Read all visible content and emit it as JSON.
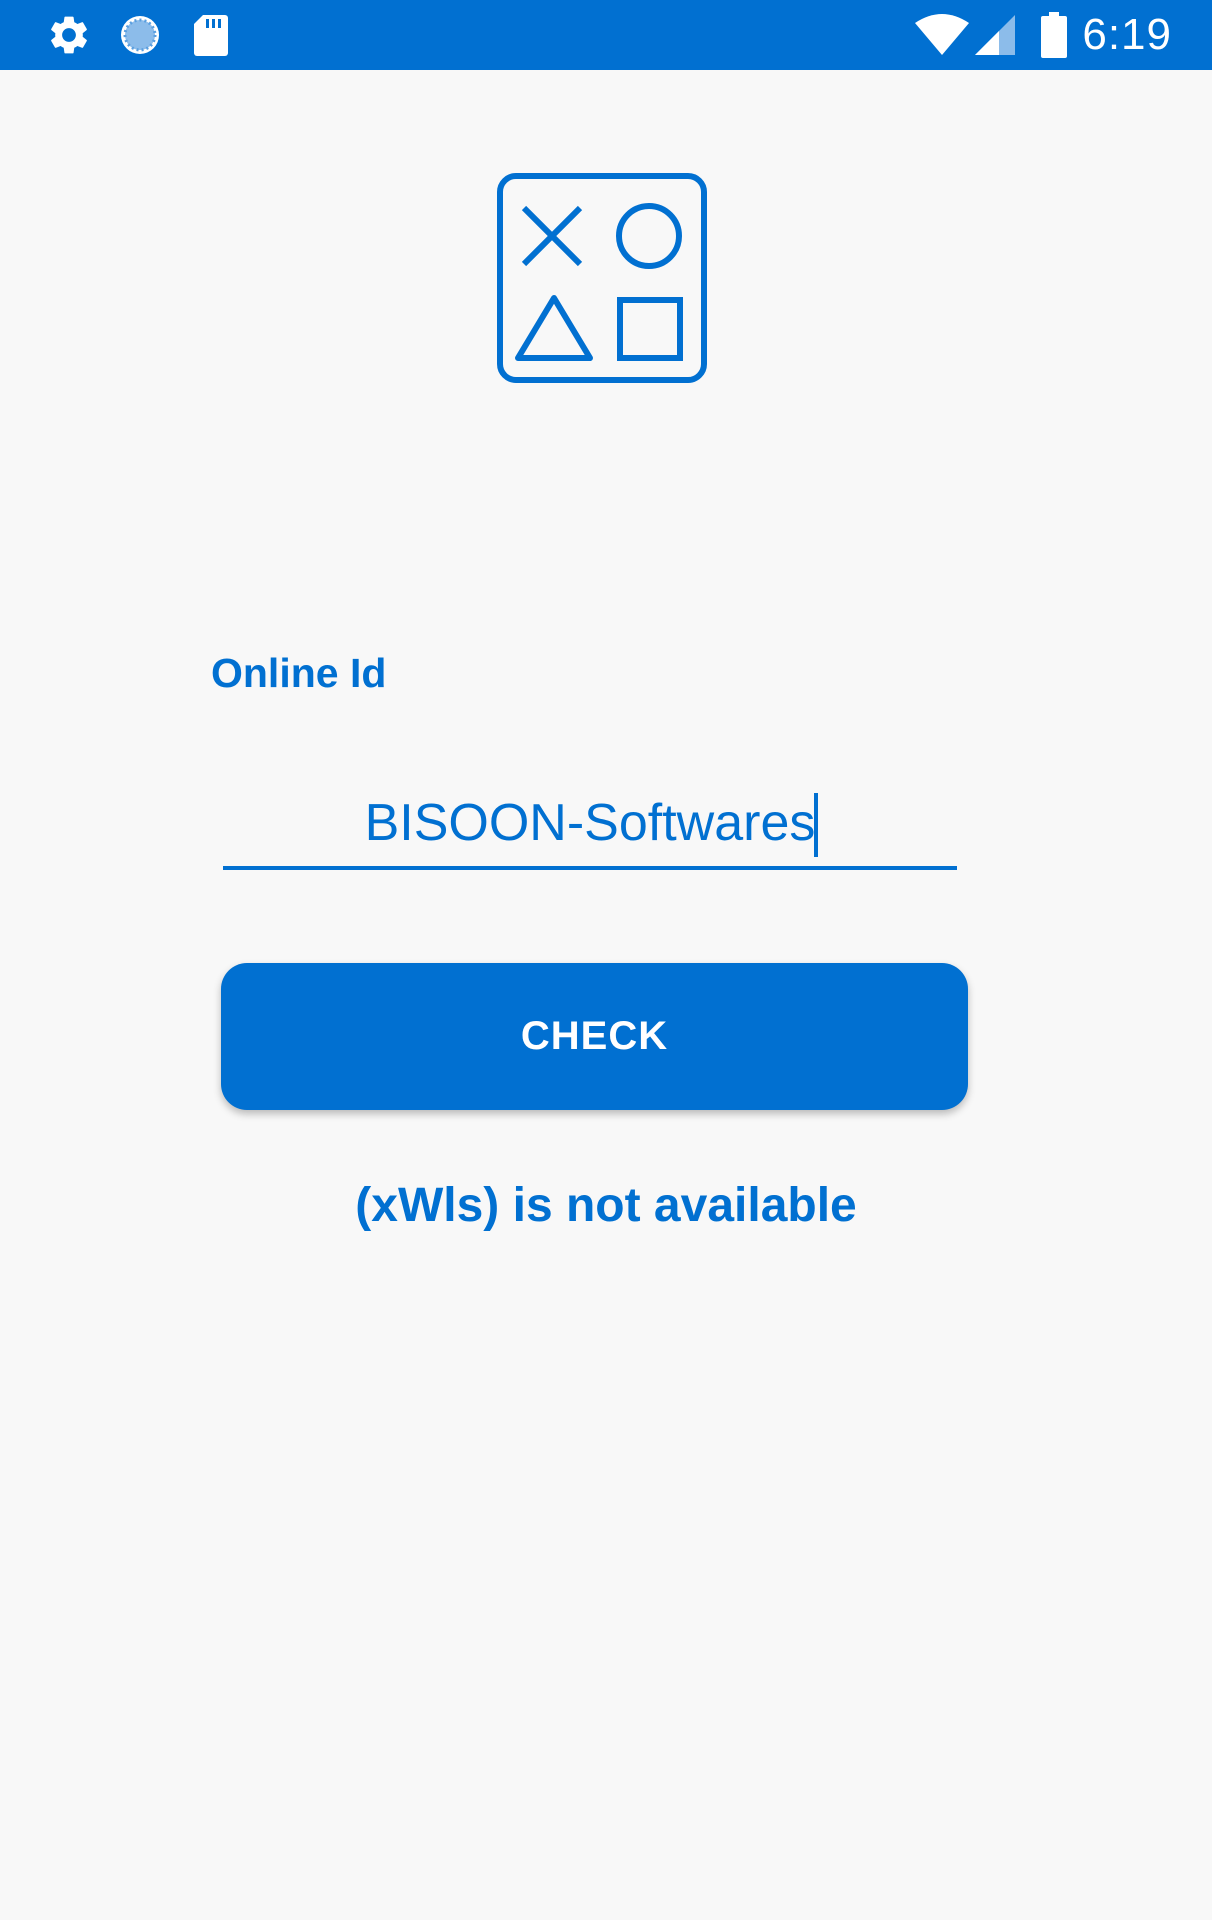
{
  "status_bar": {
    "time": "6:19",
    "left_icons": [
      "gear-icon",
      "sync-icon",
      "sd-card-icon"
    ],
    "right_icons": [
      "wifi-icon",
      "cellular-signal-icon",
      "battery-icon"
    ]
  },
  "app": {
    "logo": "game-symbols-icon",
    "field_label": "Online Id",
    "input_value": "BISOON-Softwares",
    "check_label": "CHECK",
    "availability_message": "(xWls) is not available"
  },
  "colors": {
    "accent": "#0170d1",
    "background": "#f8f8f8",
    "status_bar": "#0170d1"
  }
}
